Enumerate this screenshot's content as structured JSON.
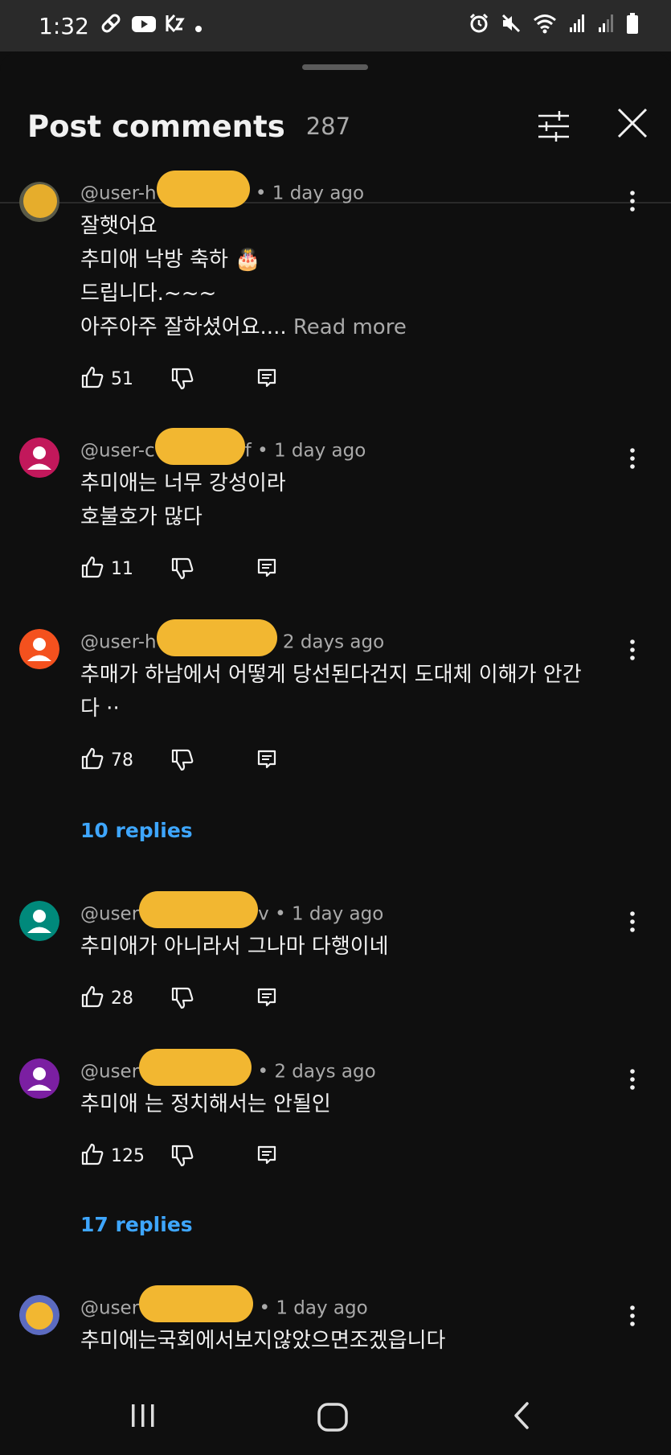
{
  "status_bar": {
    "time": "1:32",
    "left_icons": [
      "link-icon",
      "youtube-icon",
      "notification-icon",
      "dot-icon"
    ],
    "right_icons": [
      "alarm-icon",
      "mute-icon",
      "wifi-icon",
      "signal-icon",
      "signal-icon-2",
      "battery-icon"
    ]
  },
  "header": {
    "title": "Post comments",
    "count": "287",
    "filter_icon": "filter-icon",
    "close_icon": "close-icon"
  },
  "comments": [
    {
      "handle_start": "@user-h",
      "handle_end": "",
      "time": "• 1 day ago",
      "text": "잘햇어요\n추미애 낙방 축하 🎂\n드립니다.~~~\n아주아주 잘하셨어요....",
      "read_more": "Read more",
      "likes": "51",
      "avatar_color": "#e6ad2c"
    },
    {
      "handle_start": "@user-c",
      "handle_end": "f",
      "time": "• 1 day ago",
      "text": "추미애는 너무 강성이라\n호불호가 많다",
      "likes": "11",
      "avatar_color": "#c2185b"
    },
    {
      "handle_start": "@user-h",
      "handle_end": "",
      "time": "2 days ago",
      "text": "추매가 하남에서 어떻게 당선된다건지 도대체 이해가 안간\n다 ··",
      "likes": "78",
      "replies": "10 replies",
      "avatar_color": "#f4511e"
    },
    {
      "handle_start": "@user",
      "handle_end": "v",
      "time": "• 1 day ago",
      "text": "추미애가 아니라서 그나마  다행이네",
      "likes": "28",
      "avatar_color": "#00897b"
    },
    {
      "handle_start": "@user",
      "handle_end": "",
      "time": "• 2 days ago",
      "text": "추미애 는 정치해서는 안될인",
      "likes": "125",
      "replies": "17 replies",
      "avatar_color": "#7b1fa2"
    },
    {
      "handle_start": "@user",
      "handle_end": "",
      "time": "• 1 day ago",
      "text": "추미에는국회에서보지않았으면조겠읍니다",
      "avatar_color": "#5c6bc0"
    }
  ],
  "nav_bar": {
    "icons": [
      "recent-apps-icon",
      "home-icon",
      "back-icon"
    ]
  }
}
